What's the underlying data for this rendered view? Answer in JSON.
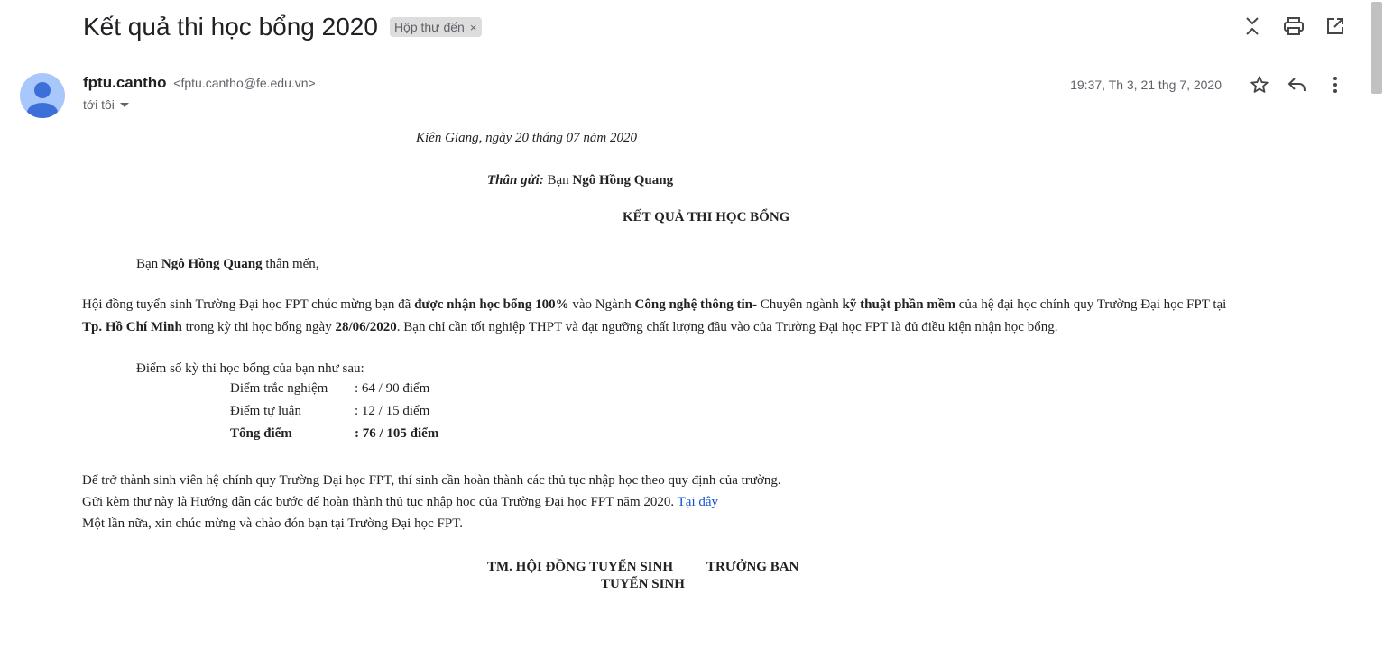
{
  "header": {
    "subject": "Kết quả thi học bổng 2020",
    "label": "Hộp thư đến",
    "label_close": "×"
  },
  "toolbar": {
    "icons": [
      "collapse-icon",
      "print-icon",
      "open-new-window-icon"
    ]
  },
  "sender": {
    "name": "fptu.cantho",
    "email": "<fptu.cantho@fe.edu.vn>",
    "to": "tới tôi",
    "date": "19:37, Th 3, 21 thg 7, 2020"
  },
  "letter": {
    "place_date": "Kiên Giang, ngày 20 tháng  07 năm 2020",
    "greeting_label": "Thân gửi:",
    "greeting_prefix": "Bạn",
    "recipient": "Ngô Hồng Quang",
    "heading": "KẾT QUẢ THI HỌC BỔNG",
    "salutation_prefix": "Bạn",
    "salutation_suffix": "thân mến,",
    "p1_a": "Hội đồng tuyển sinh Trường Đại học FPT chúc mừng bạn đã",
    "p1_b": "được nhận học bổng 100%",
    "p1_c": "vào Ngành",
    "p1_d": "Công nghệ thông tin",
    "p1_e": "- Chuyên ngành",
    "p1_f": "kỹ thuật phần mềm",
    "p1_g": "của hệ đại học chính quy Trường Đại học FPT tại",
    "p1_h": "Tp. Hồ Chí Minh",
    "p1_i": "trong kỳ thi học bổng ngày",
    "p1_j": "28/06/2020",
    "p1_k": ". Bạn chỉ cần tốt nghiệp THPT và đạt ngưỡng chất lượng đầu vào của Trường Đại học FPT là đủ điều kiện nhận học bổng.",
    "scores_intro": "Điểm số kỳ thi học bổng của bạn như sau:",
    "scores": [
      {
        "label": "Điểm trắc nghiệm",
        "value": ":  64 / 90 điểm"
      },
      {
        "label": "Điểm tự luận",
        "value": ":  12 / 15 điểm"
      },
      {
        "label": "Tổng điểm",
        "value": ":  76 / 105 điểm"
      }
    ],
    "p2": "Để trở thành sinh viên hệ chính quy Trường Đại học FPT, thí sinh cần hoàn thành các thủ tục nhập học theo quy định của trường.",
    "p3": "Gửi kèm thư này là Hướng dẫn các bước để hoàn thành thủ tục nhập học của Trường Đại học FPT năm 2020.",
    "p3_link": "Tại đây",
    "p4": "Một lần nữa, xin chúc mừng và chào đón bạn tại Trường Đại học FPT.",
    "sig_1": "TM. HỘI ĐỒNG TUYỂN SINH",
    "sig_2": "TRƯỞNG BAN",
    "sig_3": "TUYỂN SINH"
  }
}
